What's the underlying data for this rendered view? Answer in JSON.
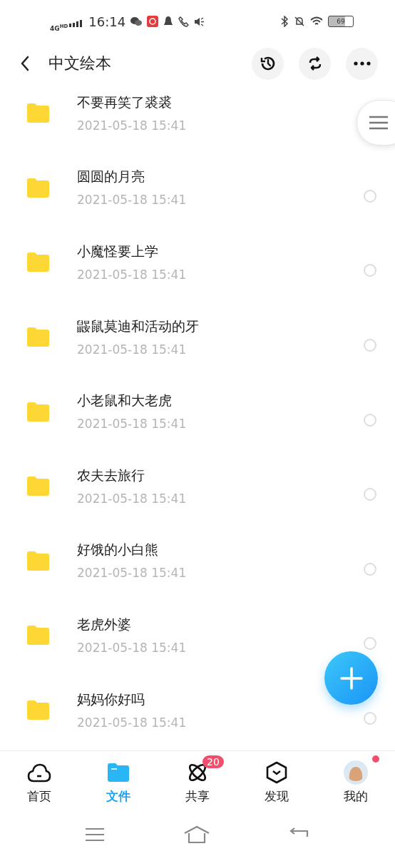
{
  "status_bar": {
    "network": "4G",
    "network_badge": "HD",
    "time": "16:14",
    "battery": "69"
  },
  "header": {
    "title": "中文绘本"
  },
  "files": [
    {
      "name": "不要再笑了裘裘",
      "date": "2021-05-18  15:41"
    },
    {
      "name": "圆圆的月亮",
      "date": "2021-05-18  15:41",
      "selected": false
    },
    {
      "name": "小魔怪要上学",
      "date": "2021-05-18  15:41",
      "selected": false
    },
    {
      "name": "鼹鼠莫迪和活动的牙",
      "date": "2021-05-18  15:41",
      "selected": false
    },
    {
      "name": "小老鼠和大老虎",
      "date": "2021-05-18  15:41",
      "selected": false
    },
    {
      "name": "农夫去旅行",
      "date": "2021-05-18  15:41",
      "selected": false
    },
    {
      "name": "好饿的小白熊",
      "date": "2021-05-18  15:41",
      "selected": false
    },
    {
      "name": "老虎外婆",
      "date": "2021-05-18  15:41",
      "selected": false
    },
    {
      "name": "妈妈你好吗",
      "date": "2021-05-18  15:41",
      "selected": false
    }
  ],
  "tabs": [
    {
      "kind": "home",
      "label": "首页",
      "selected": false
    },
    {
      "kind": "files",
      "label": "文件",
      "selected": true
    },
    {
      "kind": "share",
      "label": "共享",
      "selected": false,
      "badge": "20"
    },
    {
      "kind": "discover",
      "label": "发现",
      "selected": false
    },
    {
      "kind": "me",
      "label": "我的",
      "selected": false,
      "dot": true
    }
  ]
}
